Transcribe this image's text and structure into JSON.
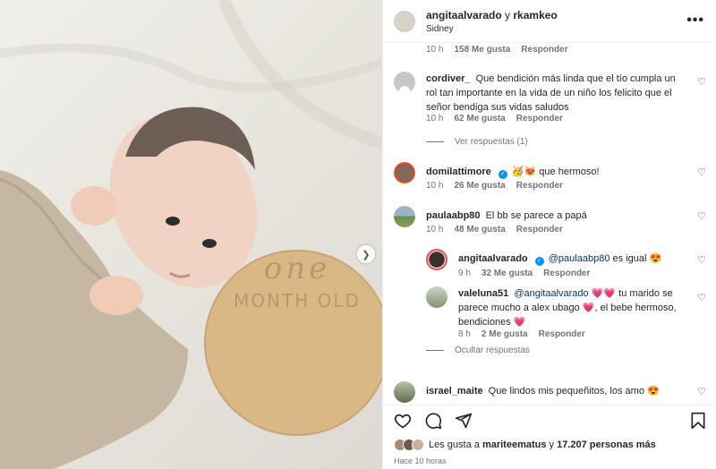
{
  "header": {
    "user1": "angitaalvarado",
    "connector": "y",
    "user2": "rkamkeo",
    "location": "Sidney",
    "more_icon": "more-horizontal-icon"
  },
  "photo": {
    "plaque_line1": "one",
    "plaque_line2": "MONTH OLD",
    "next_icon": "chevron-right-icon"
  },
  "comments": [
    {
      "time": "10 h",
      "likes": "158 Me gusta",
      "reply": "Responder"
    },
    {
      "username": "cordiver_",
      "text": "Que bendición más linda que el tío cumpla un rol tan importante en la vida de un niño los felicito que el señor bendiga sus vidas saludos",
      "time": "10 h",
      "likes": "62 Me gusta",
      "reply": "Responder",
      "view_replies": "Ver respuestas (1)"
    },
    {
      "username": "domilattimore",
      "text": "🥳😻 que hermoso!",
      "time": "10 h",
      "likes": "26 Me gusta",
      "reply": "Responder"
    },
    {
      "username": "paulaabp80",
      "text": "El bb se parece a papá",
      "time": "10 h",
      "likes": "48 Me gusta",
      "reply": "Responder",
      "hide_replies": "Ocultar respuestas"
    },
    {
      "username": "israel_maite",
      "text": "Que lindos mis pequeñitos, los amo 😍"
    }
  ],
  "replies": [
    {
      "username": "angitaalvarado",
      "mention": "@paulaabp80",
      "text": "es igual 😍",
      "time": "9 h",
      "likes": "32 Me gusta",
      "reply": "Responder"
    },
    {
      "username": "valeluna51",
      "mention": "@angitaalvarado",
      "text": "💗💗 tu marido se parece mucho a alex ubago 💗, el bebe hermoso, bendiciones 💗",
      "time": "8 h",
      "likes": "2 Me gusta",
      "reply": "Responder"
    }
  ],
  "footer": {
    "likes_prefix": "Les gusta a",
    "liker": "mariteematus",
    "likes_mid": "y",
    "likes_count": "17.207 personas más",
    "time_ago": "Hace 10 horas",
    "icons": [
      "heart-icon",
      "comment-icon",
      "share-icon",
      "bookmark-icon"
    ]
  },
  "colors": {
    "text": "#262626",
    "muted": "#737373",
    "link": "#00376b",
    "verified": "#0095f6",
    "plaque": "#d9b886"
  }
}
